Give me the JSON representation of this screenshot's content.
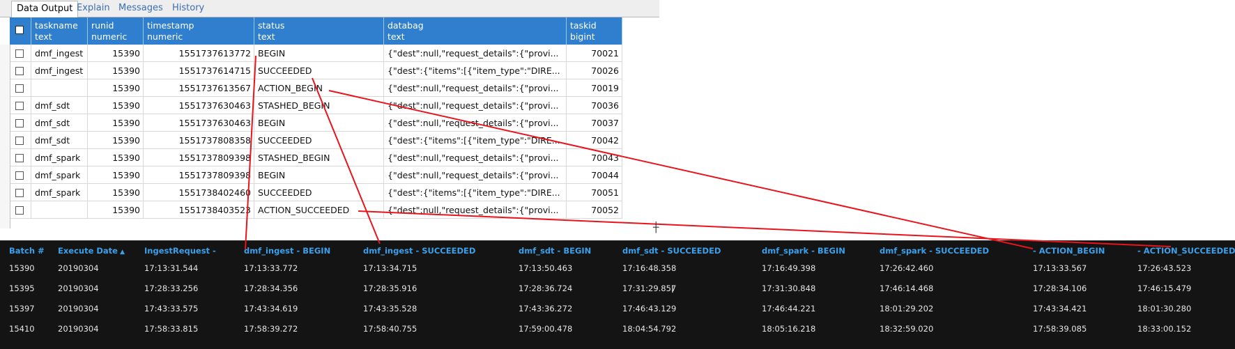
{
  "tabs": [
    "Data Output",
    "Explain",
    "Messages",
    "History"
  ],
  "active_tab": 0,
  "grid": {
    "columns": [
      {
        "name": "taskname",
        "type": "text"
      },
      {
        "name": "runid",
        "type": "numeric"
      },
      {
        "name": "timestamp",
        "type": "numeric"
      },
      {
        "name": "status",
        "type": "text"
      },
      {
        "name": "databag",
        "type": "text"
      },
      {
        "name": "taskid",
        "type": "bigint"
      }
    ],
    "rows": [
      [
        "dmf_ingest",
        "15390",
        "1551737613772",
        "BEGIN",
        "{\"dest\":null,\"request_details\":{\"provi...",
        "70021"
      ],
      [
        "dmf_ingest",
        "15390",
        "1551737614715",
        "SUCCEEDED",
        "{\"dest\":{\"items\":[{\"item_type\":\"DIRE...",
        "70026"
      ],
      [
        "",
        "15390",
        "1551737613567",
        "ACTION_BEGIN",
        "{\"dest\":null,\"request_details\":{\"provi...",
        "70019"
      ],
      [
        "dmf_sdt",
        "15390",
        "1551737630463",
        "STASHED_BEGIN",
        "{\"dest\":null,\"request_details\":{\"provi...",
        "70036"
      ],
      [
        "dmf_sdt",
        "15390",
        "1551737630463",
        "BEGIN",
        "{\"dest\":null,\"request_details\":{\"provi...",
        "70037"
      ],
      [
        "dmf_sdt",
        "15390",
        "1551737808358",
        "SUCCEEDED",
        "{\"dest\":{\"items\":[{\"item_type\":\"DIRE...",
        "70042"
      ],
      [
        "dmf_spark",
        "15390",
        "1551737809398",
        "STASHED_BEGIN",
        "{\"dest\":null,\"request_details\":{\"provi...",
        "70043"
      ],
      [
        "dmf_spark",
        "15390",
        "1551737809398",
        "BEGIN",
        "{\"dest\":null,\"request_details\":{\"provi...",
        "70044"
      ],
      [
        "dmf_spark",
        "15390",
        "1551738402460",
        "SUCCEEDED",
        "{\"dest\":{\"items\":[{\"item_type\":\"DIRE...",
        "70051"
      ],
      [
        "",
        "15390",
        "1551738403523",
        "ACTION_SUCCEEDED",
        "{\"dest\":null,\"request_details\":{\"provi...",
        "70052"
      ]
    ]
  },
  "batch_table": {
    "headers": [
      "Batch #",
      "Execute Date",
      "IngestRequest -",
      "dmf_ingest - BEGIN",
      "dmf_ingest - SUCCEEDED",
      "dmf_sdt - BEGIN",
      "dmf_sdt - SUCCEEDED",
      "dmf_spark - BEGIN",
      "dmf_spark - SUCCEEDED",
      "- ACTION_BEGIN",
      "- ACTION_SUCCEEDED"
    ],
    "sort_column": 1,
    "sort_indicator": "▲",
    "rows": [
      [
        "15390",
        "20190304",
        "17:13:31.544",
        "17:13:33.772",
        "17:13:34.715",
        "17:13:50.463",
        "17:16:48.358",
        "17:16:49.398",
        "17:26:42.460",
        "17:13:33.567",
        "17:26:43.523"
      ],
      [
        "15395",
        "20190304",
        "17:28:33.256",
        "17:28:34.356",
        "17:28:35.916",
        "17:28:36.724",
        "17:31:29.857",
        "17:31:30.848",
        "17:46:14.468",
        "17:28:34.106",
        "17:46:15.479"
      ],
      [
        "15397",
        "20190304",
        "17:43:33.575",
        "17:43:34.619",
        "17:43:35.528",
        "17:43:36.272",
        "17:46:43.129",
        "17:46:44.221",
        "18:01:29.202",
        "17:43:34.421",
        "18:01:30.280"
      ],
      [
        "15410",
        "20190304",
        "17:58:33.815",
        "17:58:39.272",
        "17:58:40.755",
        "17:59:00.478",
        "18:04:54.792",
        "18:05:16.218",
        "18:32:59.020",
        "17:58:39.085",
        "18:33:00.152"
      ]
    ]
  },
  "colors": {
    "header_blue": "#2f7fce",
    "link_blue": "#3aa0ea",
    "annotation_red": "#e8141c",
    "dark_bg": "#141414"
  }
}
